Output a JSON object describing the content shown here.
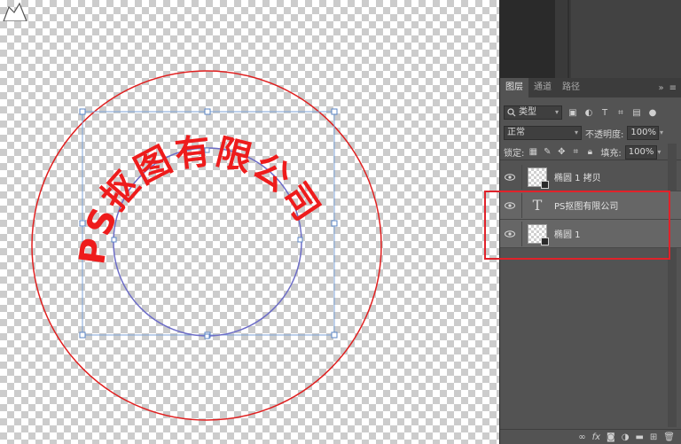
{
  "canvas": {
    "arc_text": "PS抠图有限公司",
    "text_color": "#ee1c1c",
    "outer_circle_color": "#e02020",
    "inner_path_color": "#6d6dc7",
    "bbox_color": "#7da3d9"
  },
  "panel": {
    "tabs": [
      {
        "label": "图层",
        "active": true
      },
      {
        "label": "通道",
        "active": false
      },
      {
        "label": "路径",
        "active": false
      }
    ],
    "tab_tools": {
      "expand": "»",
      "menu": "≡"
    },
    "filter": {
      "kind_label": "类型",
      "icons": [
        "image-filter-icon",
        "adjustment-filter-icon",
        "type-filter-icon",
        "shape-filter-icon",
        "smart-object-filter-icon",
        "filter-toggle-icon"
      ]
    },
    "blend": {
      "mode": "正常",
      "opacity_label": "不透明度:",
      "opacity_value": "100%"
    },
    "lock": {
      "label": "锁定:",
      "fill_label": "填充:",
      "fill_value": "100%"
    },
    "layers": [
      {
        "name": "椭圆 1 拷贝",
        "type": "shape",
        "selected": false
      },
      {
        "name": "PS抠图有限公司",
        "type": "text",
        "selected": true
      },
      {
        "name": "椭圆 1",
        "type": "shape",
        "selected": true
      }
    ],
    "highlight_color": "#e0222a",
    "bottom_icons": [
      "link-icon",
      "fx-icon",
      "mask-icon",
      "adjustment-layer-icon",
      "group-icon",
      "new-layer-icon",
      "trash-icon"
    ]
  }
}
